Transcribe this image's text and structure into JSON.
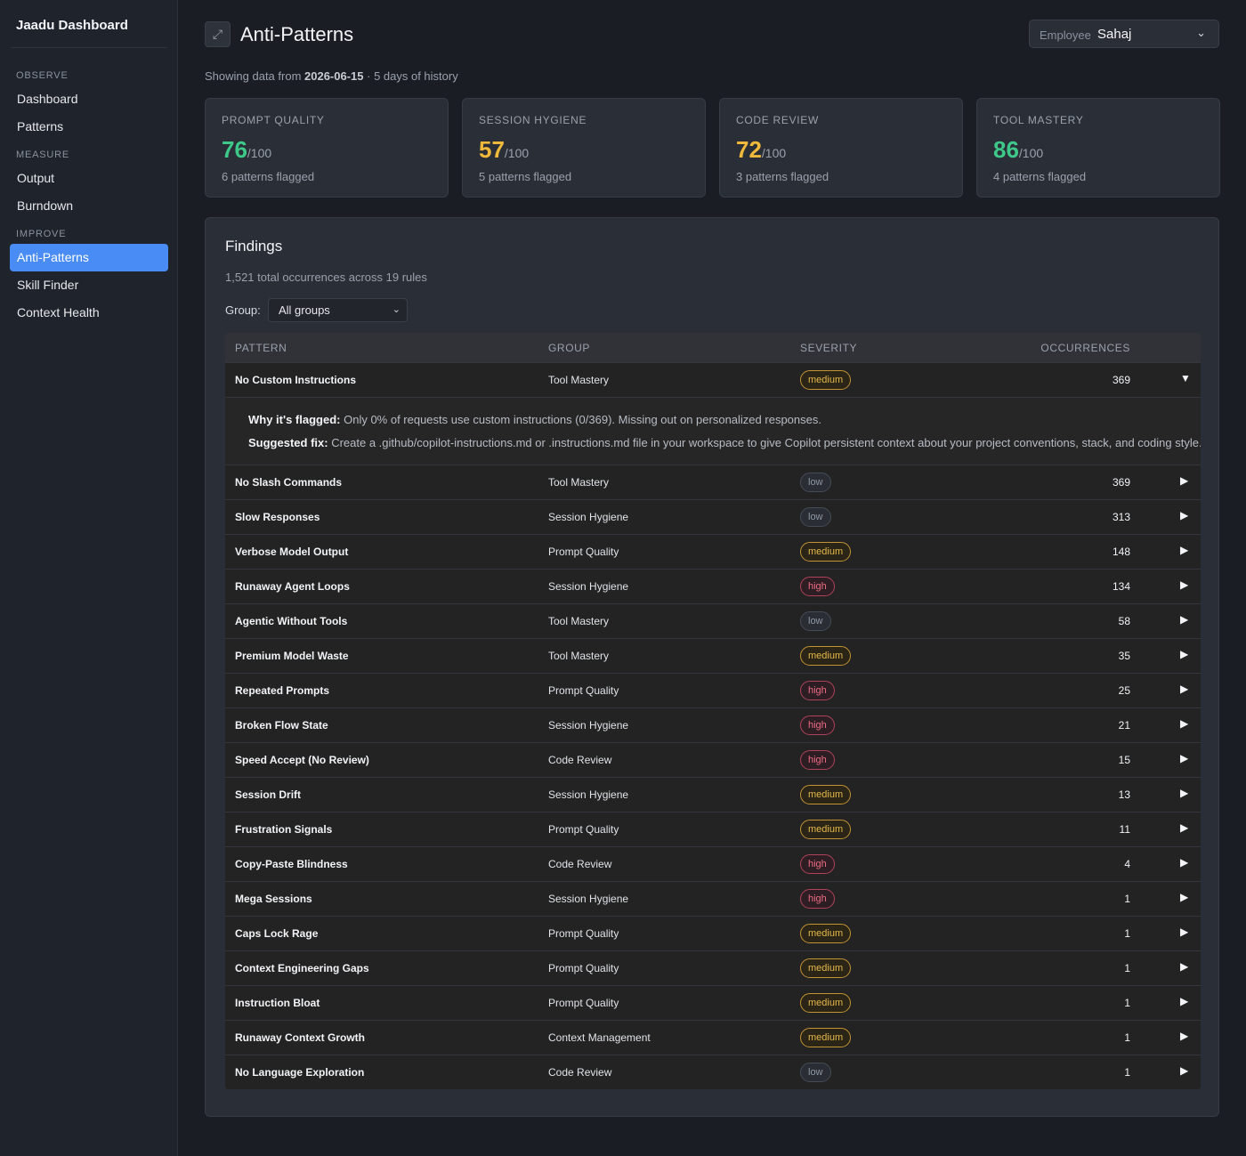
{
  "sidebar": {
    "brand": "Jaadu Dashboard",
    "sections": [
      {
        "label": "OBSERVE",
        "items": [
          {
            "label": "Dashboard"
          },
          {
            "label": "Patterns"
          }
        ]
      },
      {
        "label": "MEASURE",
        "items": [
          {
            "label": "Output"
          },
          {
            "label": "Burndown"
          }
        ]
      },
      {
        "label": "IMPROVE",
        "items": [
          {
            "label": "Anti-Patterns",
            "active": true
          },
          {
            "label": "Skill Finder"
          },
          {
            "label": "Context Health"
          }
        ]
      }
    ]
  },
  "header": {
    "title": "Anti-Patterns",
    "expand_icon": "expand-icon",
    "employee_label": "Employee",
    "employee_value": "Sahaj"
  },
  "subtitle": {
    "prefix": "Showing data from ",
    "date": "2026-06-15",
    "suffix": " · 5 days of history"
  },
  "cards": [
    {
      "label": "PROMPT QUALITY",
      "score": "76",
      "denominator": "/100",
      "sub": "6 patterns flagged",
      "color": "#3ec98a"
    },
    {
      "label": "SESSION HYGIENE",
      "score": "57",
      "denominator": "/100",
      "sub": "5 patterns flagged",
      "color": "#f0b93b"
    },
    {
      "label": "CODE REVIEW",
      "score": "72",
      "denominator": "/100",
      "sub": "3 patterns flagged",
      "color": "#f0b93b"
    },
    {
      "label": "TOOL MASTERY",
      "score": "86",
      "denominator": "/100",
      "sub": "4 patterns flagged",
      "color": "#3ec98a"
    }
  ],
  "findings": {
    "title": "Findings",
    "subtitle": "1,521 total occurrences across 19 rules",
    "group_label": "Group:",
    "group_value": "All groups",
    "columns": {
      "pattern": "PATTERN",
      "group": "GROUP",
      "severity": "SEVERITY",
      "occurrences": "OCCURRENCES"
    },
    "rows": [
      {
        "pattern": "No Custom Instructions",
        "group": "Tool Mastery",
        "severity": "medium",
        "occurrences": "369",
        "expanded": true,
        "why_label": "Why it's flagged:",
        "why": " Only 0% of requests use custom instructions (0/369). Missing out on personalized responses.",
        "fix_label": "Suggested fix:",
        "fix": " Create a .github/copilot-instructions.md or .instructions.md file in your workspace to give Copilot persistent context about your project conventions, stack, and coding style."
      },
      {
        "pattern": "No Slash Commands",
        "group": "Tool Mastery",
        "severity": "low",
        "occurrences": "369"
      },
      {
        "pattern": "Slow Responses",
        "group": "Session Hygiene",
        "severity": "low",
        "occurrences": "313"
      },
      {
        "pattern": "Verbose Model Output",
        "group": "Prompt Quality",
        "severity": "medium",
        "occurrences": "148"
      },
      {
        "pattern": "Runaway Agent Loops",
        "group": "Session Hygiene",
        "severity": "high",
        "occurrences": "134"
      },
      {
        "pattern": "Agentic Without Tools",
        "group": "Tool Mastery",
        "severity": "low",
        "occurrences": "58"
      },
      {
        "pattern": "Premium Model Waste",
        "group": "Tool Mastery",
        "severity": "medium",
        "occurrences": "35"
      },
      {
        "pattern": "Repeated Prompts",
        "group": "Prompt Quality",
        "severity": "high",
        "occurrences": "25"
      },
      {
        "pattern": "Broken Flow State",
        "group": "Session Hygiene",
        "severity": "high",
        "occurrences": "21"
      },
      {
        "pattern": "Speed Accept (No Review)",
        "group": "Code Review",
        "severity": "high",
        "occurrences": "15"
      },
      {
        "pattern": "Session Drift",
        "group": "Session Hygiene",
        "severity": "medium",
        "occurrences": "13"
      },
      {
        "pattern": "Frustration Signals",
        "group": "Prompt Quality",
        "severity": "medium",
        "occurrences": "11"
      },
      {
        "pattern": "Copy-Paste Blindness",
        "group": "Code Review",
        "severity": "high",
        "occurrences": "4"
      },
      {
        "pattern": "Mega Sessions",
        "group": "Session Hygiene",
        "severity": "high",
        "occurrences": "1"
      },
      {
        "pattern": "Caps Lock Rage",
        "group": "Prompt Quality",
        "severity": "medium",
        "occurrences": "1"
      },
      {
        "pattern": "Context Engineering Gaps",
        "group": "Prompt Quality",
        "severity": "medium",
        "occurrences": "1"
      },
      {
        "pattern": "Instruction Bloat",
        "group": "Prompt Quality",
        "severity": "medium",
        "occurrences": "1"
      },
      {
        "pattern": "Runaway Context Growth",
        "group": "Context Management",
        "severity": "medium",
        "occurrences": "1"
      },
      {
        "pattern": "No Language Exploration",
        "group": "Code Review",
        "severity": "low",
        "occurrences": "1"
      }
    ],
    "expanded_glyph": "▼",
    "collapsed_glyph": "▶"
  }
}
